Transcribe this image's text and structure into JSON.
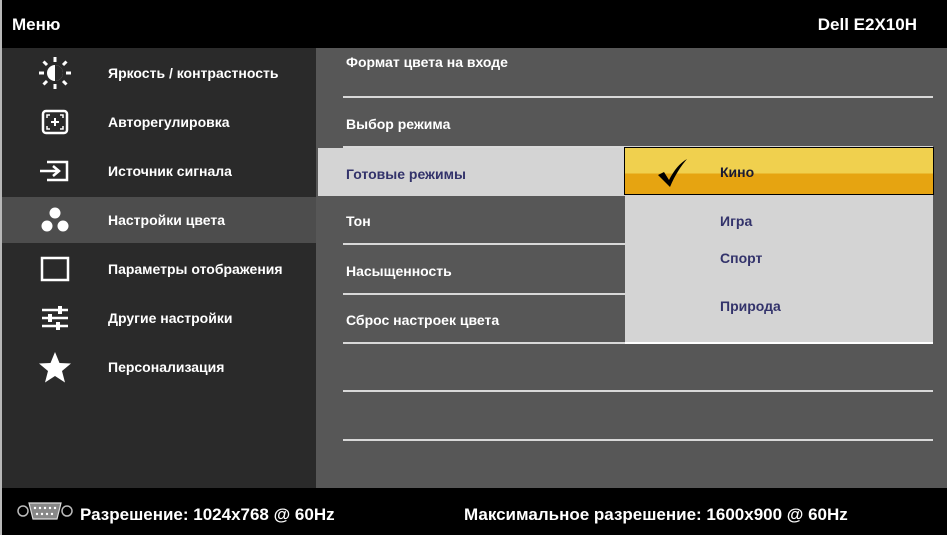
{
  "header": {
    "menu_title": "Меню",
    "model": "Dell E2X10H"
  },
  "sidebar": {
    "items": [
      {
        "label": "Яркость / контрастность",
        "icon": "brightness-icon"
      },
      {
        "label": "Авторегулировка",
        "icon": "auto-adjust-icon"
      },
      {
        "label": "Источник сигнала",
        "icon": "input-source-icon"
      },
      {
        "label": "Настройки цвета",
        "icon": "color-settings-icon",
        "selected": true
      },
      {
        "label": "Параметры отображения",
        "icon": "display-settings-icon"
      },
      {
        "label": "Другие настройки",
        "icon": "other-settings-icon"
      },
      {
        "label": "Персонализация",
        "icon": "star-icon"
      }
    ]
  },
  "submenu": {
    "items": [
      {
        "label": "Формат цвета на входе"
      },
      {
        "label": "Выбор режима"
      },
      {
        "label": "Готовые режимы",
        "highlighted": true
      },
      {
        "label": "Тон"
      },
      {
        "label": "Насыщенность"
      },
      {
        "label": "Сброс настроек цвета"
      }
    ]
  },
  "preset_modes": {
    "options": [
      {
        "label": "Кино",
        "selected": true
      },
      {
        "label": "Игра"
      },
      {
        "label": "Спорт"
      },
      {
        "label": "Природа"
      }
    ]
  },
  "footer": {
    "resolution": "Разрешение: 1024x768 @ 60Hz",
    "max_resolution": "Максимальное разрешение: 1600x900 @ 60Hz"
  },
  "colors": {
    "background": "#000000",
    "left_panel": "#2a2a2a",
    "right_panel": "#575757",
    "highlight": "#d4d4d4",
    "selected_option": "#f0d04e",
    "highlight_text": "#33336b"
  }
}
